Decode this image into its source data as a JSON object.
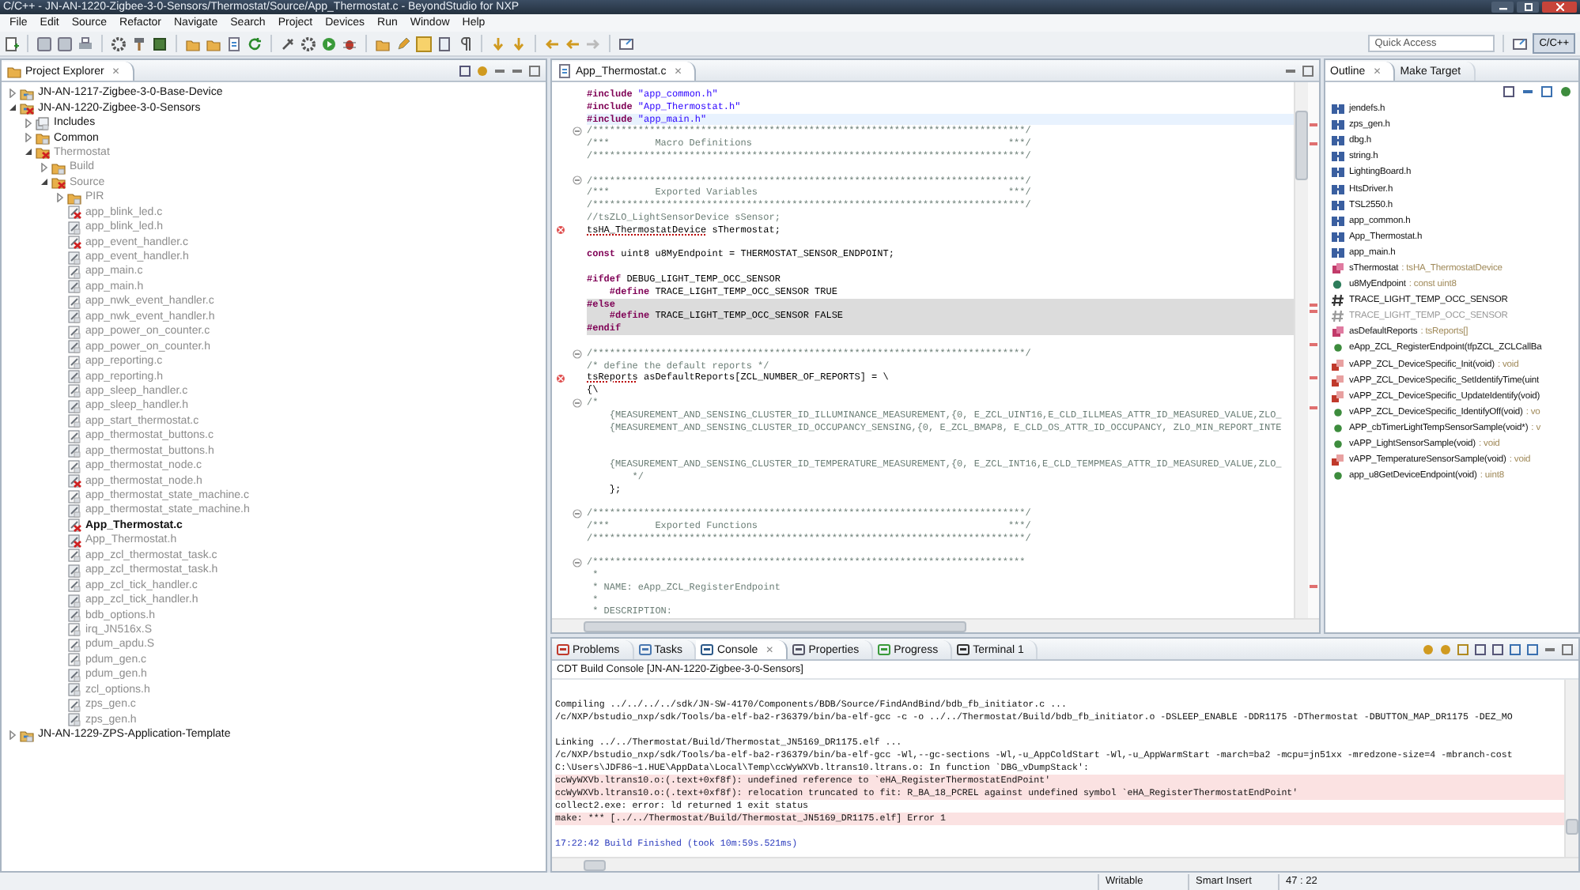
{
  "window": {
    "title": "C/C++ - JN-AN-1220-Zigbee-3-0-Sensors/Thermostat/Source/App_Thermostat.c - BeyondStudio for NXP"
  },
  "menu": [
    "File",
    "Edit",
    "Source",
    "Refactor",
    "Navigate",
    "Search",
    "Project",
    "Devices",
    "Run",
    "Window",
    "Help"
  ],
  "quick_access": {
    "placeholder": "Quick Access"
  },
  "perspective": {
    "label": "C/C++",
    "selected": true
  },
  "project_explorer": {
    "title": "Project Explorer",
    "close": "✕",
    "tree": [
      {
        "name": "JN-AN-1217-Zigbee-3-0-Base-Device",
        "kind": "project",
        "expanded": false,
        "error": false,
        "dimmed": false
      },
      {
        "name": "JN-AN-1220-Zigbee-3-0-Sensors",
        "kind": "project",
        "expanded": true,
        "error": true,
        "dimmed": false,
        "children": [
          {
            "name": "Includes",
            "kind": "includes",
            "expanded": false,
            "error": false,
            "dimmed": false
          },
          {
            "name": "Common",
            "kind": "folder",
            "expanded": false,
            "error": false,
            "dimmed": false
          },
          {
            "name": "Thermostat",
            "kind": "folder",
            "expanded": true,
            "error": true,
            "dimmed": true,
            "children": [
              {
                "name": "Build",
                "kind": "folder",
                "expanded": false,
                "error": false,
                "dimmed": true
              },
              {
                "name": "Source",
                "kind": "folder",
                "expanded": true,
                "error": true,
                "dimmed": true,
                "children": [
                  {
                    "name": "PIR",
                    "kind": "folder",
                    "expanded": false,
                    "error": false,
                    "dimmed": true
                  },
                  {
                    "name": "app_blink_led.c",
                    "kind": "c",
                    "error": true,
                    "dimmed": true,
                    "selected": false
                  },
                  {
                    "name": "app_blink_led.h",
                    "kind": "h",
                    "error": false,
                    "dimmed": true,
                    "selected": false
                  },
                  {
                    "name": "app_event_handler.c",
                    "kind": "c",
                    "error": true,
                    "dimmed": true,
                    "selected": false
                  },
                  {
                    "name": "app_event_handler.h",
                    "kind": "h",
                    "error": false,
                    "dimmed": true,
                    "selected": false
                  },
                  {
                    "name": "app_main.c",
                    "kind": "c",
                    "error": false,
                    "dimmed": true,
                    "selected": false
                  },
                  {
                    "name": "app_main.h",
                    "kind": "h",
                    "error": false,
                    "dimmed": true,
                    "selected": false
                  },
                  {
                    "name": "app_nwk_event_handler.c",
                    "kind": "c",
                    "error": false,
                    "dimmed": true,
                    "selected": false
                  },
                  {
                    "name": "app_nwk_event_handler.h",
                    "kind": "h",
                    "error": false,
                    "dimmed": true,
                    "selected": false
                  },
                  {
                    "name": "app_power_on_counter.c",
                    "kind": "c",
                    "error": false,
                    "dimmed": true,
                    "selected": false
                  },
                  {
                    "name": "app_power_on_counter.h",
                    "kind": "h",
                    "error": false,
                    "dimmed": true,
                    "selected": false
                  },
                  {
                    "name": "app_reporting.c",
                    "kind": "c",
                    "error": false,
                    "dimmed": true,
                    "selected": false
                  },
                  {
                    "name": "app_reporting.h",
                    "kind": "h",
                    "error": false,
                    "dimmed": true,
                    "selected": false
                  },
                  {
                    "name": "app_sleep_handler.c",
                    "kind": "c",
                    "error": false,
                    "dimmed": true,
                    "selected": false
                  },
                  {
                    "name": "app_sleep_handler.h",
                    "kind": "h",
                    "error": false,
                    "dimmed": true,
                    "selected": false
                  },
                  {
                    "name": "app_start_thermostat.c",
                    "kind": "c",
                    "error": false,
                    "dimmed": true,
                    "selected": false
                  },
                  {
                    "name": "app_thermostat_buttons.c",
                    "kind": "c",
                    "error": false,
                    "dimmed": true,
                    "selected": false
                  },
                  {
                    "name": "app_thermostat_buttons.h",
                    "kind": "h",
                    "error": false,
                    "dimmed": true,
                    "selected": false
                  },
                  {
                    "name": "app_thermostat_node.c",
                    "kind": "c",
                    "error": false,
                    "dimmed": true,
                    "selected": false
                  },
                  {
                    "name": "app_thermostat_node.h",
                    "kind": "h",
                    "error": true,
                    "dimmed": true,
                    "selected": false
                  },
                  {
                    "name": "app_thermostat_state_machine.c",
                    "kind": "c",
                    "error": false,
                    "dimmed": true,
                    "selected": false
                  },
                  {
                    "name": "app_thermostat_state_machine.h",
                    "kind": "h",
                    "error": false,
                    "dimmed": true,
                    "selected": false
                  },
                  {
                    "name": "App_Thermostat.c",
                    "kind": "c",
                    "error": true,
                    "dimmed": false,
                    "selected": true
                  },
                  {
                    "name": "App_Thermostat.h",
                    "kind": "h",
                    "error": true,
                    "dimmed": true,
                    "selected": false
                  },
                  {
                    "name": "app_zcl_thermostat_task.c",
                    "kind": "c",
                    "error": false,
                    "dimmed": true,
                    "selected": false
                  },
                  {
                    "name": "app_zcl_thermostat_task.h",
                    "kind": "h",
                    "error": false,
                    "dimmed": true,
                    "selected": false
                  },
                  {
                    "name": "app_zcl_tick_handler.c",
                    "kind": "c",
                    "error": false,
                    "dimmed": true,
                    "selected": false
                  },
                  {
                    "name": "app_zcl_tick_handler.h",
                    "kind": "h",
                    "error": false,
                    "dimmed": true,
                    "selected": false
                  },
                  {
                    "name": "bdb_options.h",
                    "kind": "h",
                    "error": false,
                    "dimmed": true,
                    "selected": false
                  },
                  {
                    "name": "irq_JN516x.S",
                    "kind": "s",
                    "error": false,
                    "dimmed": true,
                    "selected": false
                  },
                  {
                    "name": "pdum_apdu.S",
                    "kind": "s",
                    "error": false,
                    "dimmed": true,
                    "selected": false
                  },
                  {
                    "name": "pdum_gen.c",
                    "kind": "c",
                    "error": false,
                    "dimmed": true,
                    "selected": false
                  },
                  {
                    "name": "pdum_gen.h",
                    "kind": "h",
                    "error": false,
                    "dimmed": true,
                    "selected": false
                  },
                  {
                    "name": "zcl_options.h",
                    "kind": "h",
                    "error": false,
                    "dimmed": true,
                    "selected": false
                  },
                  {
                    "name": "zps_gen.c",
                    "kind": "c",
                    "error": false,
                    "dimmed": true,
                    "selected": false
                  },
                  {
                    "name": "zps_gen.h",
                    "kind": "h",
                    "error": false,
                    "dimmed": true,
                    "selected": false
                  }
                ]
              }
            ]
          }
        ]
      },
      {
        "name": "JN-AN-1229-ZPS-Application-Template",
        "kind": "project",
        "expanded": false,
        "error": false,
        "dimmed": false
      }
    ]
  },
  "editor": {
    "tab": "App_Thermostat.c",
    "close": "✕",
    "lines": [
      {
        "kind": "plain",
        "parts": [
          {
            "kind": "keyword",
            "text": "#include"
          },
          {
            "kind": "string",
            "text": " \"app_common.h\""
          }
        ]
      },
      {
        "kind": "plain",
        "parts": [
          {
            "kind": "keyword",
            "text": "#include"
          },
          {
            "kind": "string",
            "text": " \"App_Thermostat.h\""
          }
        ]
      },
      {
        "kind": "current",
        "parts": [
          {
            "kind": "keyword",
            "text": "#include"
          },
          {
            "kind": "string",
            "text": " \"app_main.h\""
          }
        ]
      },
      {
        "kind": "plain",
        "fold": true,
        "parts": [
          {
            "kind": "comment",
            "text": "/****************************************************************************/"
          }
        ]
      },
      {
        "kind": "plain",
        "parts": [
          {
            "kind": "comment",
            "text": "/***        Macro Definitions                                             ***/"
          }
        ]
      },
      {
        "kind": "plain",
        "parts": [
          {
            "kind": "comment",
            "text": "/****************************************************************************/"
          }
        ]
      },
      {
        "kind": "plain"
      },
      {
        "kind": "plain",
        "fold": true,
        "parts": [
          {
            "kind": "comment",
            "text": "/****************************************************************************/"
          }
        ]
      },
      {
        "kind": "plain",
        "parts": [
          {
            "kind": "comment",
            "text": "/***        Exported Variables                                            ***/"
          }
        ]
      },
      {
        "kind": "plain",
        "parts": [
          {
            "kind": "comment",
            "text": "/****************************************************************************/"
          }
        ]
      },
      {
        "kind": "plain",
        "parts": [
          {
            "kind": "comment",
            "text": "//tsZLO_LightSensorDevice sSensor;"
          }
        ]
      },
      {
        "kind": "plain",
        "error": true,
        "parts": [
          {
            "kind": "unresolved",
            "text": "tsHA_ThermostatDevice"
          },
          {
            "kind": "code",
            "text": " sThermostat;"
          }
        ]
      },
      {
        "kind": "plain"
      },
      {
        "kind": "plain",
        "parts": [
          {
            "kind": "keyword",
            "text": "const"
          },
          {
            "kind": "code",
            "text": " uint8 u8MyEndpoint = THERMOSTAT_SENSOR_ENDPOINT;"
          }
        ]
      },
      {
        "kind": "plain"
      },
      {
        "kind": "plain",
        "parts": [
          {
            "kind": "keyword",
            "text": "#ifdef"
          },
          {
            "kind": "code",
            "text": " DEBUG_LIGHT_TEMP_OCC_SENSOR"
          }
        ]
      },
      {
        "kind": "plain",
        "parts": [
          {
            "kind": "keyword",
            "text": "    #define"
          },
          {
            "kind": "code",
            "text": " TRACE_LIGHT_TEMP_OCC_SENSOR TRUE"
          }
        ]
      },
      {
        "kind": "inactive",
        "parts": [
          {
            "kind": "keyword",
            "text": "#else"
          }
        ]
      },
      {
        "kind": "inactive",
        "parts": [
          {
            "kind": "keyword",
            "text": "    #define"
          },
          {
            "kind": "code",
            "text": " TRACE_LIGHT_TEMP_OCC_SENSOR FALSE"
          }
        ]
      },
      {
        "kind": "inactive",
        "parts": [
          {
            "kind": "keyword",
            "text": "#endif"
          }
        ]
      },
      {
        "kind": "plain"
      },
      {
        "kind": "plain",
        "fold": true,
        "parts": [
          {
            "kind": "comment",
            "text": "/****************************************************************************/"
          }
        ]
      },
      {
        "kind": "plain",
        "parts": [
          {
            "kind": "comment",
            "text": "/* define the default reports */"
          }
        ]
      },
      {
        "kind": "plain",
        "error": true,
        "parts": [
          {
            "kind": "unresolved",
            "text": "tsReports"
          },
          {
            "kind": "code",
            "text": " asDefaultReports[ZCL_NUMBER_OF_REPORTS] = \\"
          }
        ]
      },
      {
        "kind": "plain",
        "parts": [
          {
            "kind": "code",
            "text": "{\\"
          }
        ]
      },
      {
        "kind": "plain",
        "fold": true,
        "parts": [
          {
            "kind": "comment",
            "text": "/*"
          }
        ]
      },
      {
        "kind": "plain",
        "parts": [
          {
            "kind": "comment",
            "text": "    {MEASUREMENT_AND_SENSING_CLUSTER_ID_ILLUMINANCE_MEASUREMENT,{0, E_ZCL_UINT16,E_CLD_ILLMEAS_ATTR_ID_MEASURED_VALUE,ZLO_"
          }
        ]
      },
      {
        "kind": "plain",
        "parts": [
          {
            "kind": "comment",
            "text": "    {MEASUREMENT_AND_SENSING_CLUSTER_ID_OCCUPANCY_SENSING,{0, E_ZCL_BMAP8, E_CLD_OS_ATTR_ID_OCCUPANCY, ZLO_MIN_REPORT_INTE"
          }
        ]
      },
      {
        "kind": "plain"
      },
      {
        "kind": "plain"
      },
      {
        "kind": "plain",
        "parts": [
          {
            "kind": "comment",
            "text": "    {MEASUREMENT_AND_SENSING_CLUSTER_ID_TEMPERATURE_MEASUREMENT,{0, E_ZCL_INT16,E_CLD_TEMPMEAS_ATTR_ID_MEASURED_VALUE,ZLO_"
          }
        ]
      },
      {
        "kind": "plain",
        "parts": [
          {
            "kind": "comment",
            "text": "        */"
          }
        ]
      },
      {
        "kind": "plain",
        "parts": [
          {
            "kind": "code",
            "text": "    };"
          }
        ]
      },
      {
        "kind": "plain"
      },
      {
        "kind": "plain",
        "fold": true,
        "parts": [
          {
            "kind": "comment",
            "text": "/****************************************************************************/"
          }
        ]
      },
      {
        "kind": "plain",
        "parts": [
          {
            "kind": "comment",
            "text": "/***        Exported Functions                                            ***/"
          }
        ]
      },
      {
        "kind": "plain",
        "parts": [
          {
            "kind": "comment",
            "text": "/****************************************************************************/"
          }
        ]
      },
      {
        "kind": "plain"
      },
      {
        "kind": "plain",
        "fold": true,
        "parts": [
          {
            "kind": "comment",
            "text": "/****************************************************************************"
          }
        ]
      },
      {
        "kind": "plain",
        "parts": [
          {
            "kind": "comment",
            "text": " *"
          }
        ]
      },
      {
        "kind": "plain",
        "parts": [
          {
            "kind": "comment",
            "text": " * NAME: eApp_ZCL_RegisterEndpoint"
          }
        ]
      },
      {
        "kind": "plain",
        "parts": [
          {
            "kind": "comment",
            "text": " *"
          }
        ]
      },
      {
        "kind": "plain",
        "parts": [
          {
            "kind": "comment",
            "text": " * DESCRIPTION:"
          }
        ]
      }
    ]
  },
  "outline": {
    "tabs": [
      {
        "label": "Outline",
        "close": "✕",
        "selected": true
      },
      {
        "label": "Make Target",
        "selected": false
      }
    ],
    "items": [
      {
        "name": "jendefs.h",
        "kind": "include",
        "dimmed": false
      },
      {
        "name": "zps_gen.h",
        "kind": "include",
        "dimmed": false
      },
      {
        "name": "dbg.h",
        "kind": "include",
        "dimmed": false
      },
      {
        "name": "string.h",
        "kind": "include",
        "dimmed": false
      },
      {
        "name": "LightingBoard.h",
        "kind": "include",
        "dimmed": false
      },
      {
        "name": "HtsDriver.h",
        "kind": "include",
        "dimmed": false
      },
      {
        "name": "TSL2550.h",
        "kind": "include",
        "dimmed": false
      },
      {
        "name": "app_common.h",
        "kind": "include",
        "dimmed": false
      },
      {
        "name": "App_Thermostat.h",
        "kind": "include",
        "dimmed": false
      },
      {
        "name": "app_main.h",
        "kind": "include",
        "dimmed": false
      },
      {
        "name": "sThermostat",
        "type": ": tsHA_ThermostatDevice",
        "kind": "variable",
        "dimmed": false
      },
      {
        "name": "u8MyEndpoint",
        "type": ": const uint8",
        "kind": "field",
        "dimmed": false
      },
      {
        "name": "TRACE_LIGHT_TEMP_OCC_SENSOR",
        "kind": "macro",
        "dimmed": false
      },
      {
        "name": "TRACE_LIGHT_TEMP_OCC_SENSOR",
        "kind": "macro",
        "dimmed": true
      },
      {
        "name": "asDefaultReports",
        "type": ": tsReports[]",
        "kind": "variable",
        "dimmed": false
      },
      {
        "name": "eApp_ZCL_RegisterEndpoint(tfpZCL_ZCLCallBa",
        "kind": "function",
        "dimmed": false
      },
      {
        "name": "vAPP_ZCL_DeviceSpecific_Init(void)",
        "type": ": void",
        "kind": "static_function",
        "dimmed": false
      },
      {
        "name": "vAPP_ZCL_DeviceSpecific_SetIdentifyTime(uint",
        "kind": "static_function",
        "dimmed": false
      },
      {
        "name": "vAPP_ZCL_DeviceSpecific_UpdateIdentify(void)",
        "kind": "static_function",
        "dimmed": false
      },
      {
        "name": "vAPP_ZCL_DeviceSpecific_IdentifyOff(void)",
        "type": ": vo",
        "kind": "function",
        "dimmed": false
      },
      {
        "name": "APP_cbTimerLightTempSensorSample(void*)",
        "type": ": v",
        "kind": "function",
        "dimmed": false
      },
      {
        "name": "vAPP_LightSensorSample(void)",
        "type": ": void",
        "kind": "function",
        "dimmed": false
      },
      {
        "name": "vAPP_TemperatureSensorSample(void)",
        "type": ": void",
        "kind": "static_function",
        "dimmed": false
      },
      {
        "name": "app_u8GetDeviceEndpoint(void)",
        "type": ": uint8",
        "kind": "function",
        "dimmed": false
      }
    ]
  },
  "console": {
    "tabs": [
      {
        "label": "Problems",
        "kind": "problems",
        "selected": false
      },
      {
        "label": "Tasks",
        "kind": "tasks",
        "selected": false
      },
      {
        "label": "Console",
        "kind": "console",
        "close": "✕",
        "selected": true
      },
      {
        "label": "Properties",
        "kind": "properties",
        "selected": false
      },
      {
        "label": "Progress",
        "kind": "progress",
        "selected": false
      },
      {
        "label": "Terminal 1",
        "kind": "terminal",
        "selected": false
      }
    ],
    "header": "CDT Build Console [JN-AN-1220-Zigbee-3-0-Sensors]",
    "lines": [
      {
        "kind": "blank"
      },
      {
        "kind": "normal",
        "text": "Compiling ../../../../sdk/JN-SW-4170/Components/BDB/Source/FindAndBind/bdb_fb_initiator.c ..."
      },
      {
        "kind": "normal",
        "text": "/c/NXP/bstudio_nxp/sdk/Tools/ba-elf-ba2-r36379/bin/ba-elf-gcc -c -o ../../Thermostat/Build/bdb_fb_initiator.o -DSLEEP_ENABLE -DDR1175 -DThermostat -DBUTTON_MAP_DR1175 -DEZ_MO"
      },
      {
        "kind": "blank"
      },
      {
        "kind": "normal",
        "text": "Linking ../../Thermostat/Build/Thermostat_JN5169_DR1175.elf ..."
      },
      {
        "kind": "normal",
        "text": "/c/NXP/bstudio_nxp/sdk/Tools/ba-elf-ba2-r36379/bin/ba-elf-gcc -Wl,--gc-sections -Wl,-u_AppColdStart -Wl,-u_AppWarmStart -march=ba2 -mcpu=jn51xx -mredzone-size=4 -mbranch-cost"
      },
      {
        "kind": "normal",
        "text": "C:\\Users\\JDF86~1.HUE\\AppData\\Local\\Temp\\ccWyWXVb.ltrans10.ltrans.o: In function `DBG_vDumpStack':"
      },
      {
        "kind": "error",
        "text": "ccWyWXVb.ltrans10.o:(.text+0xf8f): undefined reference to `eHA_RegisterThermostatEndPoint'"
      },
      {
        "kind": "error",
        "text": "ccWyWXVb.ltrans10.o:(.text+0xf8f): relocation truncated to fit: R_BA_18_PCREL against undefined symbol `eHA_RegisterThermostatEndPoint'"
      },
      {
        "kind": "normal",
        "text": "collect2.exe: error: ld returned 1 exit status"
      },
      {
        "kind": "error",
        "text": "make: *** [../../Thermostat/Build/Thermostat_JN5169_DR1175.elf] Error 1"
      },
      {
        "kind": "blank"
      },
      {
        "kind": "info",
        "text": "17:22:42 Build Finished (took 10m:59s.521ms)"
      }
    ]
  },
  "status_bar": [
    "Writable",
    "Smart Insert",
    "47 : 22"
  ]
}
